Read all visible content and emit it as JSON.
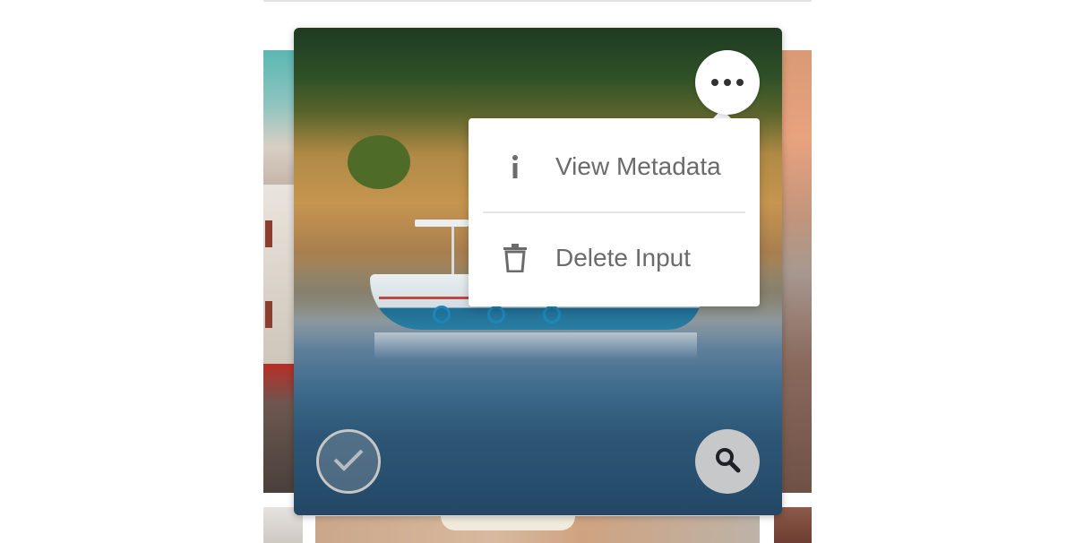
{
  "menu": {
    "items": [
      {
        "label": "View Metadata",
        "icon": "info-icon"
      },
      {
        "label": "Delete Input",
        "icon": "trash-icon"
      }
    ]
  },
  "card": {
    "more_button_icon": "more-horizontal-icon",
    "select_button_icon": "check-icon",
    "search_button_icon": "search-icon"
  },
  "colors": {
    "menu_text": "#6b6b6b",
    "more_dots": "#333333",
    "check_ring": "#c6c6c6",
    "search_bg": "#c6c8ca"
  }
}
